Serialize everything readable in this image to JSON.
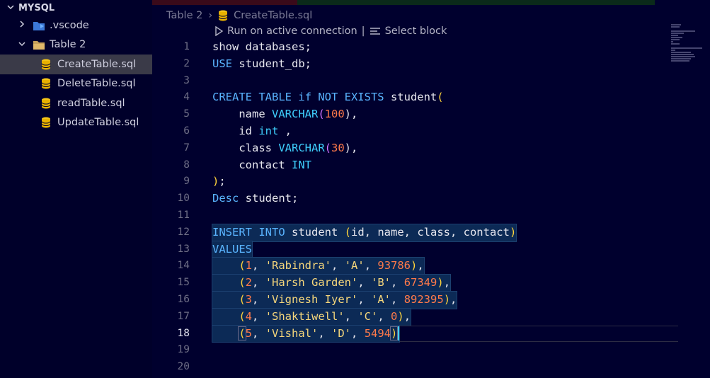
{
  "explorer": {
    "section_title": "MYSQL",
    "items": [
      {
        "label": ".vscode",
        "kind": "folder-collapsed"
      },
      {
        "label": "Table 2",
        "kind": "folder-expanded"
      },
      {
        "label": "CreateTable.sql",
        "kind": "file",
        "selected": true
      },
      {
        "label": "DeleteTable.sql",
        "kind": "file"
      },
      {
        "label": "readTable.sql",
        "kind": "file"
      },
      {
        "label": "UpdateTable.sql",
        "kind": "file"
      }
    ]
  },
  "breadcrumb": {
    "folder": "Table 2",
    "separator": "›",
    "file": "CreateTable.sql"
  },
  "codelens": {
    "run": "Run on active connection",
    "pipe": "|",
    "select": "Select block"
  },
  "editor": {
    "active_line": 18,
    "lines": [
      {
        "n": "1"
      },
      {
        "n": "2"
      },
      {
        "n": "3"
      },
      {
        "n": "4"
      },
      {
        "n": "5"
      },
      {
        "n": "6"
      },
      {
        "n": "7"
      },
      {
        "n": "8"
      },
      {
        "n": "9"
      },
      {
        "n": "10"
      },
      {
        "n": "11"
      },
      {
        "n": "12"
      },
      {
        "n": "13"
      },
      {
        "n": "14"
      },
      {
        "n": "15"
      },
      {
        "n": "16"
      },
      {
        "n": "17"
      },
      {
        "n": "18"
      },
      {
        "n": "19"
      },
      {
        "n": "20"
      }
    ],
    "code": {
      "l1": [
        "show databases;"
      ],
      "l2": [
        "USE",
        " student_db;"
      ],
      "l4": [
        "CREATE TABLE if NOT EXISTS",
        " student",
        "("
      ],
      "l5": [
        "    name ",
        "VARCHAR",
        "(",
        "100",
        "),"
      ],
      "l6": [
        "    id ",
        "int",
        " ,"
      ],
      "l7": [
        "    class ",
        "VARCHAR",
        "(",
        "30",
        "),"
      ],
      "l8": [
        "    contact ",
        "INT"
      ],
      "l9": [
        ")",
        ";"
      ],
      "l10": [
        "Desc",
        " student;"
      ],
      "l12": [
        "INSERT INTO",
        " student ",
        "(",
        "id, name, class, contact",
        ")"
      ],
      "l13": [
        "VALUES"
      ],
      "l14": [
        "    ",
        "(",
        "1",
        ", ",
        "'Rabindra'",
        ", ",
        "'A'",
        ", ",
        "93786",
        ")",
        ","
      ],
      "l15": [
        "    ",
        "(",
        "2",
        ", ",
        "'Harsh Garden'",
        ", ",
        "'B'",
        ", ",
        "67349",
        ")",
        ","
      ],
      "l16": [
        "    ",
        "(",
        "3",
        ", ",
        "'Vignesh Iyer'",
        ", ",
        "'A'",
        ", ",
        "892395",
        ")",
        ","
      ],
      "l17": [
        "    ",
        "(",
        "4",
        ", ",
        "'Shaktiwell'",
        ", ",
        "'C'",
        ", ",
        "0",
        ")",
        ","
      ],
      "l18": [
        "    ",
        "(",
        "5",
        ", ",
        "'Vishal'",
        ", ",
        "'D'",
        ", ",
        "5494",
        ")"
      ]
    }
  },
  "colors": {
    "background": "#00002e",
    "keyword": "#5ab4ff",
    "number": "#ff7a4a",
    "string": "#f5d67b",
    "bracket": "#ffd43b",
    "selection": "#0c2a56"
  },
  "icons": {
    "folder": "folder-icon",
    "vscode_folder": "vscode-folder-icon",
    "database_file": "database-icon",
    "run": "play-icon",
    "select": "select-lines-icon"
  }
}
